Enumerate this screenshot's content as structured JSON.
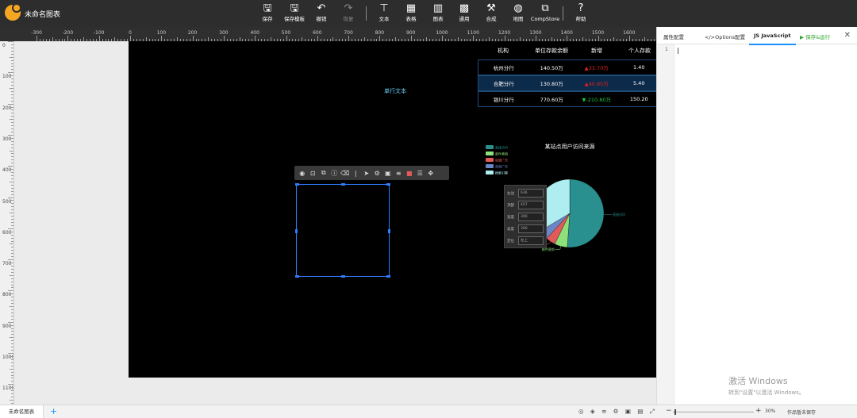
{
  "app": {
    "title": "未命名图表"
  },
  "toolbar": {
    "items": [
      {
        "icon": "save-icon",
        "label": "保存"
      },
      {
        "icon": "save-template-icon",
        "label": "保存模板"
      },
      {
        "icon": "undo-icon",
        "label": "撤销"
      },
      {
        "icon": "redo-icon",
        "label": "恢复"
      },
      {
        "icon": "text-icon",
        "label": "文本"
      },
      {
        "icon": "table-icon",
        "label": "表格"
      },
      {
        "icon": "chart-icon",
        "label": "图表"
      },
      {
        "icon": "general-icon",
        "label": "通用"
      },
      {
        "icon": "compose-icon",
        "label": "合成"
      },
      {
        "icon": "map-icon",
        "label": "地图"
      },
      {
        "icon": "compstore-icon",
        "label": "CompStore"
      },
      {
        "icon": "help-icon",
        "label": "帮助"
      }
    ]
  },
  "ruler": {
    "h": [
      "-300",
      "-200",
      "-100",
      "0",
      "100",
      "200",
      "300",
      "400",
      "500",
      "600",
      "700",
      "800",
      "900",
      "1000",
      "1100",
      "1200",
      "1300",
      "1400",
      "1500",
      "1600"
    ],
    "v": [
      "0",
      "100",
      "200",
      "300",
      "400",
      "500",
      "600",
      "700",
      "800",
      "900",
      "1000",
      "1100"
    ]
  },
  "canvas": {
    "single_text": "单行文本",
    "table": {
      "headers": [
        "机构",
        "单位存款余额",
        "新增",
        "个人存款"
      ],
      "rows": [
        {
          "org": "杭州分行",
          "balance": "140.50万",
          "delta": "▲33.70万",
          "dir": "up",
          "personal": "1.40"
        },
        {
          "org": "合肥分行",
          "balance": "130.80万",
          "delta": "▲40.80万",
          "dir": "up",
          "personal": "5.40"
        },
        {
          "org": "银川分行",
          "balance": "770.60万",
          "delta": "▼-210.80万",
          "dir": "down",
          "personal": "150.20"
        }
      ]
    }
  },
  "chart_data": {
    "type": "pie",
    "title": "某站点用户访问来源",
    "categories": [
      "直接访问",
      "邮件营销",
      "联盟广告",
      "视频广告",
      "搜索引擎"
    ],
    "values": [
      335,
      40,
      30,
      30,
      220
    ],
    "colors": [
      "#2a8f8f",
      "#8ee07a",
      "#e05a5a",
      "#6b86c7",
      "#aeeef0"
    ],
    "legend_position": "top-left"
  },
  "selection_toolbar": {
    "icons": [
      "eye-icon",
      "unlock-icon",
      "copy-icon",
      "info-icon",
      "delete-icon",
      "send-icon",
      "settings-icon",
      "save-icon",
      "sliders-icon",
      "color-icon",
      "layers-icon",
      "move-icon"
    ]
  },
  "props": {
    "rows": [
      {
        "label": "左边",
        "value": "636"
      },
      {
        "label": "顶部",
        "value": "457"
      },
      {
        "label": "宽度",
        "value": "300"
      },
      {
        "label": "高度",
        "value": "300"
      },
      {
        "label": "定位",
        "value": "左上"
      }
    ]
  },
  "right_panel": {
    "tabs": [
      "属性配置",
      "</>Options配置",
      "JS JavaScript",
      "▶ 保存&运行"
    ],
    "line": "1"
  },
  "watermark": {
    "line1": "激活 Windows",
    "line2": "转到\"设置\"以激活 Windows。"
  },
  "status": {
    "page_tab": "未命名图表",
    "add": "+",
    "zoom": "30%",
    "save_state": "作品暂未保存",
    "icons": "◎ ◈ ≡ ⚙ ▣ ▤ ⤢"
  }
}
